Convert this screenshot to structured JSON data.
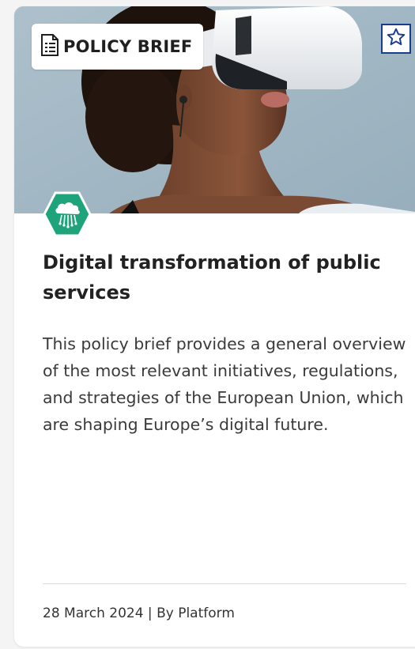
{
  "card": {
    "tag_label": "POLICY BRIEF",
    "tag_icon": "document-list-icon",
    "favorite_icon": "star-outline-icon",
    "topic_icon": "cloud-network-icon",
    "title": "Digital transformation of public services",
    "description": "This policy brief provides a general overview of the most relevant initiatives, regulations, and strategies of the European Union, which are shaping Europe’s digital future.",
    "date": "28 March 2024",
    "separator": " | ",
    "author": "By Platform"
  },
  "colors": {
    "accent_blue": "#1a3d8f",
    "topic_green": "#1fa37a",
    "hero_background": "#a3b8c5"
  }
}
